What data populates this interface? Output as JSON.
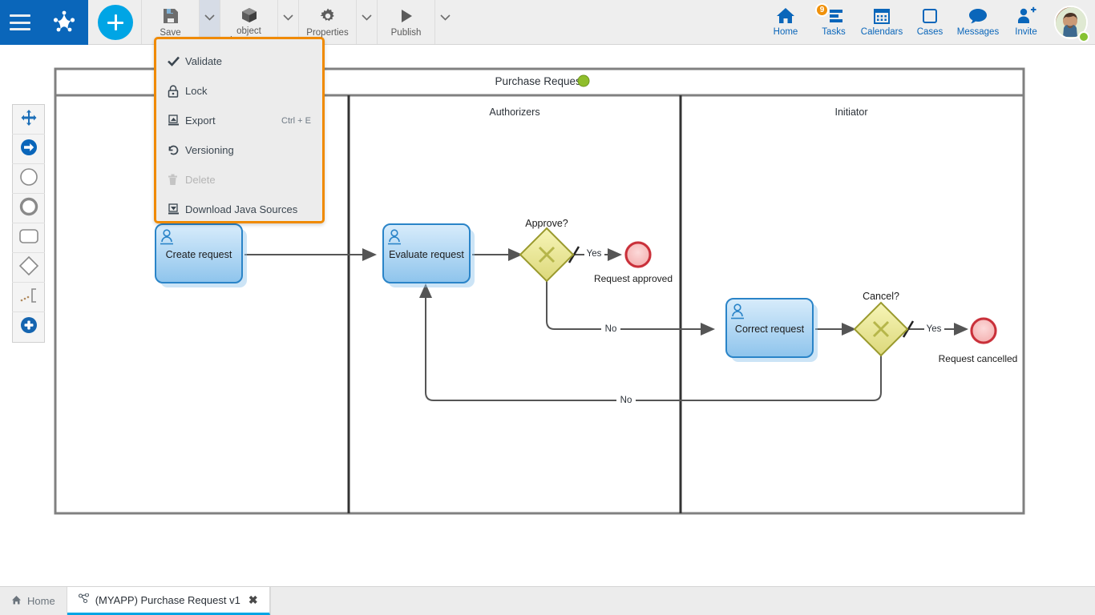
{
  "app": {
    "brand": {
      "menu_icon": "hamburger-menu-icon",
      "logo_icon": "bizagi-logo-icon"
    },
    "add_button": {
      "icon": "plus-icon",
      "label": "+"
    }
  },
  "toolbar": {
    "left_buttons": [
      {
        "id": "save",
        "label": "Save",
        "icon": "floppy-disk-icon",
        "has_caret": true,
        "caret_active": true
      },
      {
        "id": "object-inspector",
        "label": "object\ninspector",
        "icon": "cube-icon",
        "has_caret": true,
        "caret_active": false
      },
      {
        "id": "properties",
        "label": "Properties",
        "icon": "gear-icon",
        "has_caret": true,
        "caret_active": false
      },
      {
        "id": "publish",
        "label": "Publish",
        "icon": "play-triangle-icon",
        "has_caret": true,
        "caret_active": false
      }
    ],
    "right_buttons": [
      {
        "id": "home",
        "label": "Home",
        "icon": "house-icon",
        "badge": null
      },
      {
        "id": "tasks",
        "label": "Tasks",
        "icon": "task-list-icon",
        "badge": "9"
      },
      {
        "id": "calendars",
        "label": "Calendars",
        "icon": "calendar-icon",
        "badge": null
      },
      {
        "id": "cases",
        "label": "Cases",
        "icon": "square-icon",
        "badge": null
      },
      {
        "id": "messages",
        "label": "Messages",
        "icon": "chat-bubble-icon",
        "badge": null
      },
      {
        "id": "invite",
        "label": "Invite",
        "icon": "user-plus-icon",
        "badge": null
      }
    ],
    "avatar": {
      "name": "user-avatar",
      "status": "online",
      "status_color": "#86c232"
    }
  },
  "dropdown_menu": {
    "accent_color": "#f08a00",
    "items": [
      {
        "id": "validate",
        "label": "Validate",
        "icon": "check-icon",
        "shortcut": "",
        "disabled": false
      },
      {
        "id": "lock",
        "label": "Lock",
        "icon": "padlock-icon",
        "shortcut": "",
        "disabled": false
      },
      {
        "id": "export",
        "label": "Export",
        "icon": "export-icon",
        "shortcut": "Ctrl + E",
        "disabled": false
      },
      {
        "id": "versioning",
        "label": "Versioning",
        "icon": "history-icon",
        "shortcut": "",
        "disabled": false
      },
      {
        "id": "delete",
        "label": "Delete",
        "icon": "trash-icon",
        "shortcut": "",
        "disabled": true
      },
      {
        "id": "download-java-sources",
        "label": "Download Java Sources",
        "icon": "download-icon",
        "shortcut": "",
        "disabled": false
      }
    ]
  },
  "palette": {
    "items": [
      {
        "id": "pan",
        "icon": "move-cross-icon"
      },
      {
        "id": "sequence-flow",
        "icon": "arrow-right-circle-icon"
      },
      {
        "id": "start-event",
        "icon": "circle-thin-icon"
      },
      {
        "id": "end-event",
        "icon": "circle-thick-icon"
      },
      {
        "id": "task",
        "icon": "rounded-rect-icon"
      },
      {
        "id": "gateway",
        "icon": "diamond-icon"
      },
      {
        "id": "annotation",
        "icon": "annotation-icon"
      },
      {
        "id": "add-element",
        "icon": "plus-circle-icon"
      }
    ]
  },
  "diagram": {
    "pool_title": "Purchase Request",
    "pool_status_color": "#8fbe2b",
    "lanes": [
      {
        "id": "lane-1",
        "label": ""
      },
      {
        "id": "lane-2",
        "label": "Authorizers"
      },
      {
        "id": "lane-3",
        "label": "Initiator"
      }
    ],
    "tasks": [
      {
        "id": "create-request",
        "label": "Create request",
        "type": "user-task"
      },
      {
        "id": "evaluate-request",
        "label": "Evaluate request",
        "type": "user-task"
      },
      {
        "id": "correct-request",
        "label": "Correct request",
        "type": "user-task"
      }
    ],
    "gateways": [
      {
        "id": "approve-gateway",
        "label": "Approve?",
        "symbol": "X"
      },
      {
        "id": "cancel-gateway",
        "label": "Cancel?",
        "symbol": "X"
      }
    ],
    "end_events": [
      {
        "id": "request-approved",
        "label": "Request approved"
      },
      {
        "id": "request-cancelled",
        "label": "Request cancelled"
      }
    ],
    "flow_labels": [
      {
        "id": "approve-yes",
        "label": "Yes"
      },
      {
        "id": "approve-no",
        "label": "No"
      },
      {
        "id": "cancel-yes",
        "label": "Yes"
      },
      {
        "id": "cancel-no",
        "label": "No"
      }
    ],
    "colors": {
      "task_fill_top": "#cfe4f7",
      "task_fill_bottom": "#8fc4ec",
      "task_stroke": "#2a84c8",
      "gateway_fill": "#f2f0a4",
      "gateway_stroke": "#9a9a2e",
      "end_fill": "#f7bdbd",
      "end_stroke": "#c9303a",
      "connector": "#555555",
      "pool_border": "#808080"
    }
  },
  "tabs": {
    "items": [
      {
        "id": "home-tab",
        "label": "Home",
        "icon": "house-small-icon",
        "active": false,
        "closable": false
      },
      {
        "id": "diagram-tab",
        "label": "(MYAPP) Purchase Request v1",
        "icon": "process-icon",
        "active": true,
        "closable": true
      }
    ],
    "close_glyph": "✖"
  }
}
